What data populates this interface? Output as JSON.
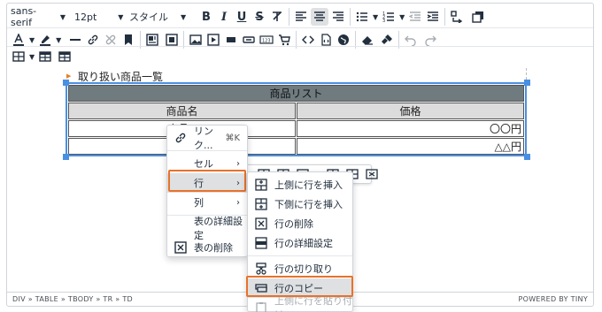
{
  "toolbar": {
    "font_family": "sans-serif",
    "font_size": "12pt",
    "style_label": "スタイル"
  },
  "content": {
    "caption": "取り扱い商品一覧",
    "table": {
      "title": "商品リスト",
      "headers": [
        "商品名",
        "価格"
      ],
      "rows": [
        [
          "商品A",
          "〇〇円"
        ],
        [
          "",
          "△△円"
        ]
      ]
    }
  },
  "statusbar": {
    "path": "DIV » TABLE » TBODY » TR » TD",
    "brand": "POWERED BY TINY"
  },
  "context_menu": {
    "items": [
      {
        "label": "リンク...",
        "shortcut": "⌘K",
        "icon": "link-icon"
      },
      {
        "label": "セル",
        "arrow": "›"
      },
      {
        "label": "行",
        "arrow": "›"
      },
      {
        "label": "列",
        "arrow": "›"
      },
      {
        "label": "表の詳細設定"
      },
      {
        "label": "表の削除",
        "icon": "table-delete-icon"
      }
    ]
  },
  "row_submenu": {
    "items": [
      {
        "label": "上側に行を挿入",
        "icon": "row-insert-before-icon"
      },
      {
        "label": "下側に行を挿入",
        "icon": "row-insert-after-icon"
      },
      {
        "label": "行の削除",
        "icon": "row-delete-icon"
      },
      {
        "label": "行の詳細設定",
        "icon": "row-properties-icon"
      },
      {
        "label": "行の切り取り",
        "icon": "row-cut-icon"
      },
      {
        "label": "行のコピー",
        "icon": "row-copy-icon"
      },
      {
        "label": "上側に行を貼り付け",
        "icon": "row-paste-icon",
        "disabled": true
      }
    ]
  },
  "colors": {
    "accent": "#4a90e2",
    "highlight": "#e8722a",
    "table_header": "#6f7b7f"
  }
}
